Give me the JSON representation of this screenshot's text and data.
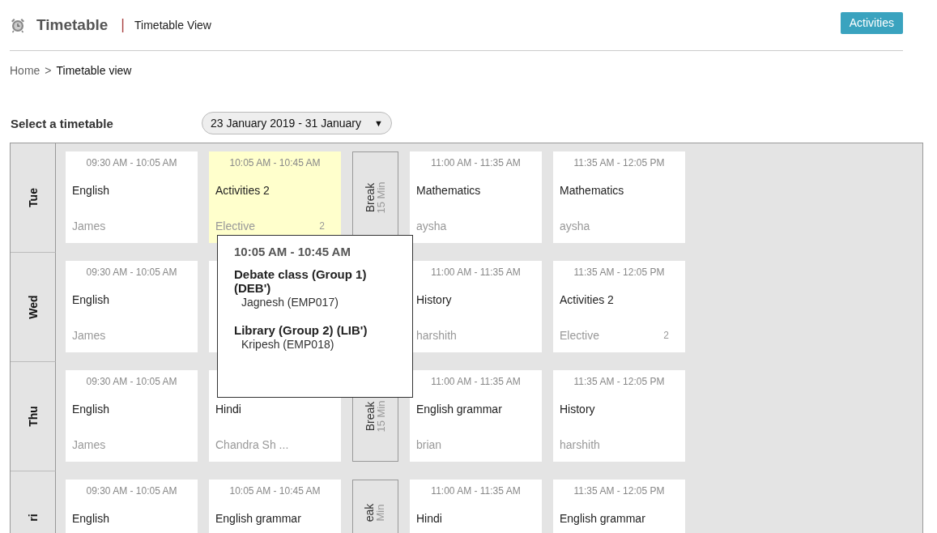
{
  "header": {
    "title": "Timetable",
    "separator": "|",
    "subtitle": "Timetable View",
    "action": "Activities"
  },
  "breadcrumb": {
    "items": [
      "Home",
      "Timetable view"
    ],
    "separator": ">"
  },
  "selector": {
    "label": "Select a timetable",
    "value": "23 January 2019 - 31 January",
    "caret": "▼"
  },
  "days": [
    {
      "day": "Tue",
      "slots": [
        {
          "kind": "lesson",
          "time": "09:30 AM - 10:05 AM",
          "subject": "English",
          "teacher": "James",
          "highlighted": false
        },
        {
          "kind": "lesson",
          "time": "10:05 AM - 10:45 AM",
          "subject": "Activities 2",
          "teacher": "Elective",
          "count": "2",
          "highlighted": true,
          "popup": {
            "time": "10:05 AM - 10:45 AM",
            "groups": [
              {
                "title": "Debate class (Group 1) (DEB')",
                "teacher": "Jagnesh (EMP017)"
              },
              {
                "title": "Library (Group 2) (LIB')",
                "teacher": "Kripesh (EMP018)"
              }
            ]
          }
        },
        {
          "kind": "break",
          "label": "Break",
          "duration": "15 Min"
        },
        {
          "kind": "lesson",
          "time": "11:00 AM - 11:35 AM",
          "subject": "Mathematics",
          "teacher": "aysha",
          "highlighted": false
        },
        {
          "kind": "lesson",
          "time": "11:35 AM - 12:05 PM",
          "subject": "Mathematics",
          "teacher": "aysha",
          "highlighted": false
        }
      ]
    },
    {
      "day": "Wed",
      "slots": [
        {
          "kind": "lesson",
          "time": "09:30 AM - 10:05 AM",
          "subject": "English",
          "teacher": "James",
          "highlighted": false
        },
        {
          "kind": "lesson",
          "highlighted": false
        },
        {
          "kind": "hidden"
        },
        {
          "kind": "lesson",
          "time": "11:00 AM - 11:35 AM",
          "subject": "History",
          "teacher": "harshith",
          "highlighted": false
        },
        {
          "kind": "lesson",
          "time": "11:35 AM - 12:05 PM",
          "subject": "Activities 2",
          "teacher": "Elective",
          "count": "2",
          "highlighted": false
        }
      ]
    },
    {
      "day": "Thu",
      "slots": [
        {
          "kind": "lesson",
          "time": "09:30 AM - 10:05 AM",
          "subject": "English",
          "teacher": "James",
          "highlighted": false
        },
        {
          "kind": "lesson",
          "subject": "Hindi",
          "teacher": "Chandra Sh ...",
          "highlighted": false
        },
        {
          "kind": "break",
          "label": "Break",
          "duration": "15 Min"
        },
        {
          "kind": "lesson",
          "time": "11:00 AM - 11:35 AM",
          "subject": "English grammar",
          "teacher": "brian",
          "highlighted": false
        },
        {
          "kind": "lesson",
          "time": "11:35 AM - 12:05 PM",
          "subject": "History",
          "teacher": "harshith",
          "highlighted": false
        }
      ]
    },
    {
      "day": "ri",
      "slots": [
        {
          "kind": "lesson",
          "time": "09:30 AM - 10:05 AM",
          "subject": "English",
          "highlighted": false
        },
        {
          "kind": "lesson",
          "time": "10:05 AM - 10:45 AM",
          "subject": "English grammar",
          "highlighted": false
        },
        {
          "kind": "break",
          "label": "eak",
          "duration": "Min"
        },
        {
          "kind": "lesson",
          "time": "11:00 AM - 11:35 AM",
          "subject": "Hindi",
          "highlighted": false
        },
        {
          "kind": "lesson",
          "time": "11:35 AM - 12:05 PM",
          "subject": "English grammar",
          "highlighted": false
        }
      ]
    }
  ]
}
